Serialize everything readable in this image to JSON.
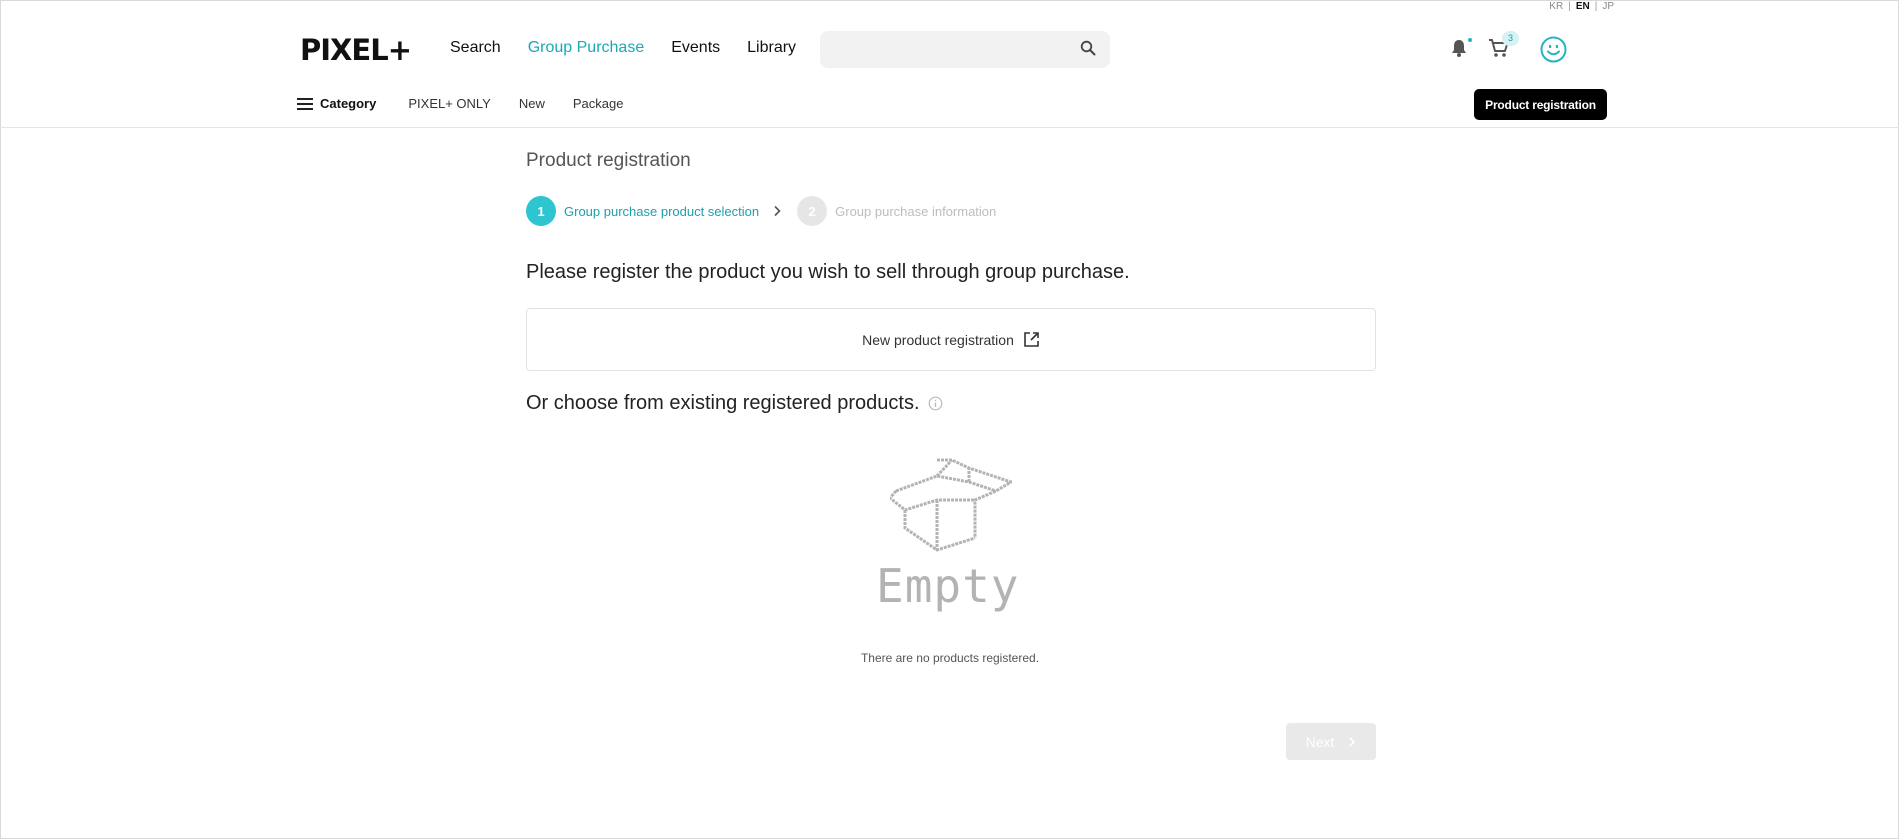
{
  "lang": {
    "kr": "KR",
    "en": "EN",
    "jp": "JP",
    "sep": "|"
  },
  "header": {
    "logo": "PIXEL+",
    "nav": [
      {
        "label": "Search"
      },
      {
        "label": "Group Purchase"
      },
      {
        "label": "Events"
      },
      {
        "label": "Library"
      }
    ],
    "search_placeholder": "",
    "cart_count": "3",
    "accent": "#27b4c1"
  },
  "subnav": {
    "category": "Category",
    "links": [
      "PIXEL+ ONLY",
      "New",
      "Package"
    ],
    "register_button": "Product registration"
  },
  "main": {
    "title": "Product registration",
    "steps": [
      {
        "num": "1",
        "label": "Group purchase product selection",
        "state": "active"
      },
      {
        "num": "2",
        "label": "Group purchase information",
        "state": "inactive"
      }
    ],
    "instruction": "Please register the product you wish to sell through group purchase.",
    "new_product_button": "New product registration",
    "or_choose": "Or choose from existing registered products.",
    "empty_label": "Empty",
    "empty_message": "There are no products registered.",
    "next_button": "Next"
  }
}
